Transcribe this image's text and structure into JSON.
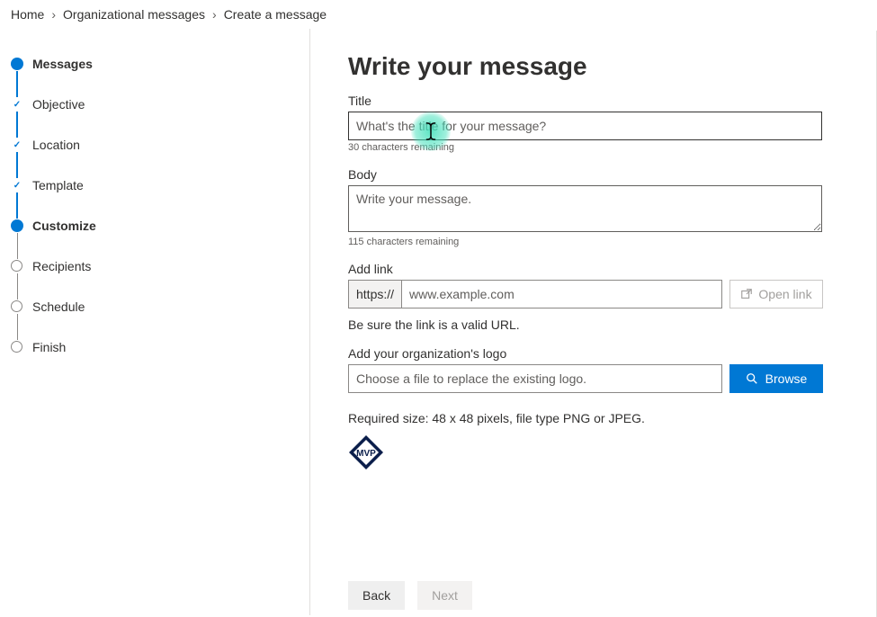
{
  "breadcrumb": {
    "items": [
      "Home",
      "Organizational messages",
      "Create a message"
    ]
  },
  "sidebar": {
    "steps": [
      {
        "label": "Messages",
        "state": "active"
      },
      {
        "label": "Objective",
        "state": "completed"
      },
      {
        "label": "Location",
        "state": "completed"
      },
      {
        "label": "Template",
        "state": "completed"
      },
      {
        "label": "Customize",
        "state": "active-sub"
      },
      {
        "label": "Recipients",
        "state": "upcoming"
      },
      {
        "label": "Schedule",
        "state": "upcoming"
      },
      {
        "label": "Finish",
        "state": "upcoming"
      }
    ]
  },
  "main": {
    "heading": "Write your message",
    "title_field": {
      "label": "Title",
      "placeholder": "What's the title for your message?",
      "helper": "30 characters remaining"
    },
    "body_field": {
      "label": "Body",
      "placeholder": "Write your message.",
      "helper": "115 characters remaining"
    },
    "link_field": {
      "label": "Add link",
      "prefix": "https://",
      "placeholder": "www.example.com",
      "open_label": "Open link",
      "hint": "Be sure the link is a valid URL."
    },
    "logo_field": {
      "label": "Add your organization's logo",
      "placeholder": "Choose a file to replace the existing logo.",
      "browse_label": "Browse",
      "requirement": "Required size: 48 x 48 pixels, file type PNG or JPEG.",
      "preview_text": "MVP"
    }
  },
  "footer": {
    "back": "Back",
    "next": "Next"
  },
  "colors": {
    "primary": "#0078d4",
    "text": "#323130",
    "muted": "#605e5c",
    "border": "#8a8886"
  }
}
